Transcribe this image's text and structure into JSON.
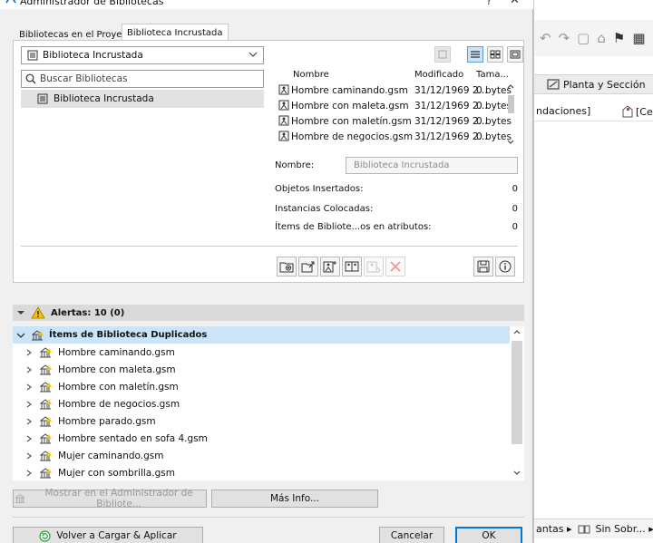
{
  "window": {
    "title": "Administrador de Bibliotecas",
    "help": "?",
    "close": "✕"
  },
  "tabs": [
    {
      "label": "Bibliotecas en el Proyecto"
    },
    {
      "label": "Biblioteca Incrustada"
    }
  ],
  "library_select": {
    "value": "Biblioteca Incrustada"
  },
  "search": {
    "placeholder": "Buscar Bibliotecas"
  },
  "library_tree": [
    {
      "label": "Biblioteca Incrustada"
    }
  ],
  "file_list": {
    "headers": {
      "name": "Nombre",
      "modified": "Modificado",
      "size": "Tama..."
    },
    "rows": [
      {
        "name": "Hombre caminando.gsm",
        "modified": "31/12/1969 2...",
        "size": "0 bytes"
      },
      {
        "name": "Hombre con maleta.gsm",
        "modified": "31/12/1969 2...",
        "size": "0 bytes"
      },
      {
        "name": "Hombre con maletín.gsm",
        "modified": "31/12/1969 2...",
        "size": "0 bytes"
      },
      {
        "name": "Hombre de negocios.gsm",
        "modified": "31/12/1969 2...",
        "size": "0 bytes"
      }
    ]
  },
  "properties": {
    "name_label": "Nombre:",
    "name_value": "Biblioteca Incrustada",
    "objects_label": "Objetos Insertados:",
    "objects_value": "0",
    "instances_label": "Instancias Colocadas:",
    "instances_value": "0",
    "items_label": "Ítems de Bibliote...os en atributos:",
    "items_value": "0"
  },
  "alerts": {
    "label": "Alertas: 10 (0)",
    "group": "Ítems de Biblioteca Duplicados",
    "items": [
      "Hombre caminando.gsm",
      "Hombre con maleta.gsm",
      "Hombre con maletín.gsm",
      "Hombre de negocios.gsm",
      "Hombre parado.gsm",
      "Hombre sentado en sofa 4.gsm",
      "Mujer caminando.gsm",
      "Mujer con sombrilla.gsm"
    ]
  },
  "buttons": {
    "show_in_manager": "Mostrar en el Administrador de Bibliote...",
    "more_info": "Más Info...",
    "reload_apply": "Volver a Cargar & Aplicar",
    "cancel": "Cancelar",
    "ok": "OK"
  },
  "background_app": {
    "tab_label": "Planta y Sección",
    "col1": "ndaciones]",
    "col2": "[Cer",
    "bottom1": "antas ▸",
    "bottom2": "Sin Sobr... ▸"
  },
  "colors": {
    "selection": "#cce4f7",
    "accent": "#0078d7",
    "alert_yellow": "#f5c400",
    "delete_red": "#e8413b",
    "reload_green": "#2e9e3a"
  }
}
